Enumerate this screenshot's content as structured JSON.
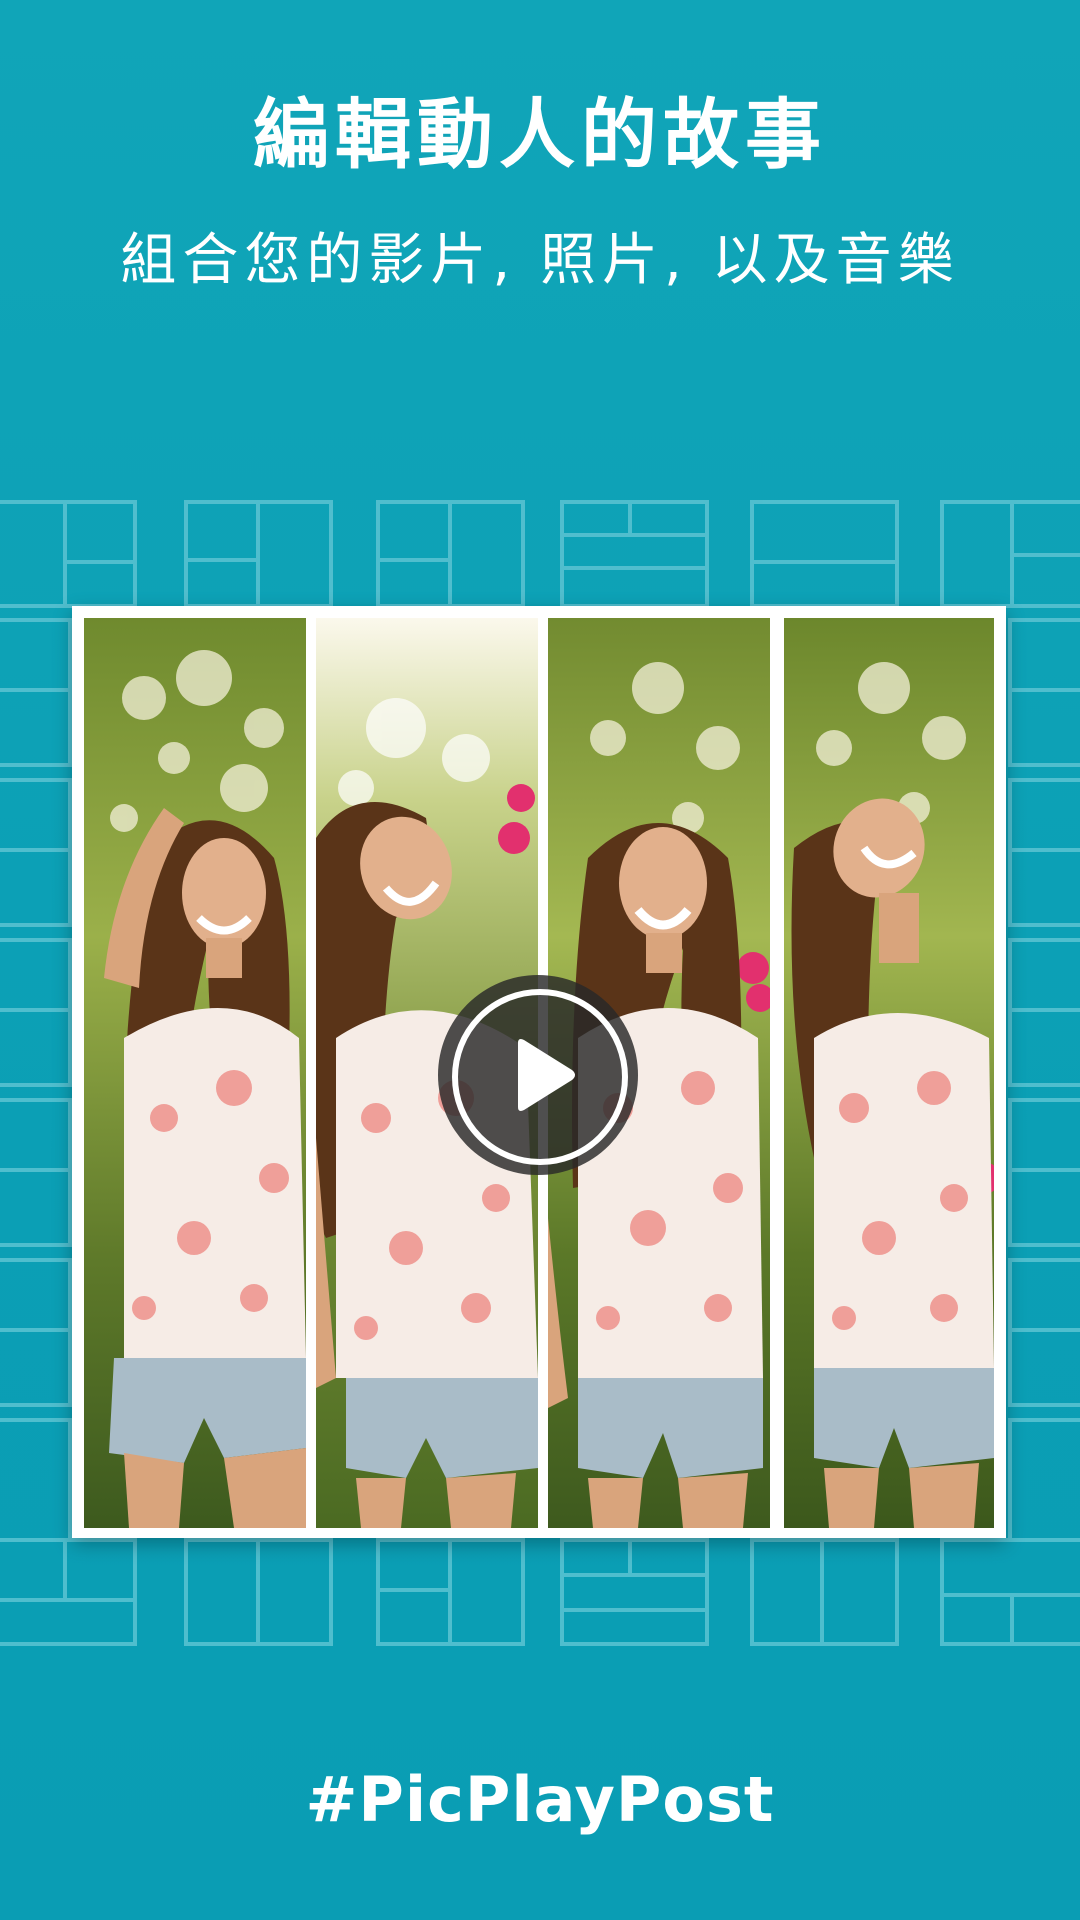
{
  "headline": "編輯動人的故事",
  "subline": "組合您的影片, 照片, 以及音樂",
  "hashtag": "#PicPlayPost",
  "colors": {
    "background": "#0ea1b6",
    "pattern_line": "#5cc4d3",
    "frame": "#ffffff",
    "text": "#ffffff"
  },
  "play_button": {
    "icon": "play-icon"
  },
  "collage": {
    "panels": [
      {
        "name": "photo-panel-1",
        "pose": "hand-in-hair"
      },
      {
        "name": "photo-panel-2",
        "pose": "head-tilted"
      },
      {
        "name": "photo-panel-3",
        "pose": "laughing"
      },
      {
        "name": "photo-panel-4",
        "pose": "looking-up"
      }
    ]
  }
}
